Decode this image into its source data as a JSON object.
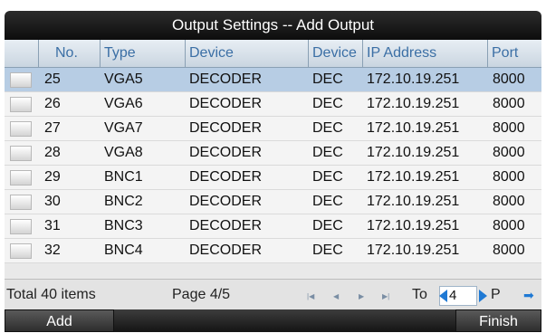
{
  "window": {
    "title": "Output Settings -- Add Output"
  },
  "table": {
    "columns": [
      "No.",
      "Type",
      "Device",
      "Device",
      "IP Address",
      "Port"
    ],
    "rows": [
      {
        "no": "25",
        "type": "VGA5",
        "device": "DECODER",
        "device_short": "DEC",
        "ip": "172.10.19.251",
        "port": "8000",
        "selected": true
      },
      {
        "no": "26",
        "type": "VGA6",
        "device": "DECODER",
        "device_short": "DEC",
        "ip": "172.10.19.251",
        "port": "8000",
        "selected": false
      },
      {
        "no": "27",
        "type": "VGA7",
        "device": "DECODER",
        "device_short": "DEC",
        "ip": "172.10.19.251",
        "port": "8000",
        "selected": false
      },
      {
        "no": "28",
        "type": "VGA8",
        "device": "DECODER",
        "device_short": "DEC",
        "ip": "172.10.19.251",
        "port": "8000",
        "selected": false
      },
      {
        "no": "29",
        "type": "BNC1",
        "device": "DECODER",
        "device_short": "DEC",
        "ip": "172.10.19.251",
        "port": "8000",
        "selected": false
      },
      {
        "no": "30",
        "type": "BNC2",
        "device": "DECODER",
        "device_short": "DEC",
        "ip": "172.10.19.251",
        "port": "8000",
        "selected": false
      },
      {
        "no": "31",
        "type": "BNC3",
        "device": "DECODER",
        "device_short": "DEC",
        "ip": "172.10.19.251",
        "port": "8000",
        "selected": false
      },
      {
        "no": "32",
        "type": "BNC4",
        "device": "DECODER",
        "device_short": "DEC",
        "ip": "172.10.19.251",
        "port": "8000",
        "selected": false
      }
    ]
  },
  "footer": {
    "total": "Total 40 items",
    "page": "Page 4/5",
    "to_label": "To",
    "page_input": "4",
    "p_label": "P",
    "nav": {
      "first": "|◀",
      "prev": "◀",
      "next": "▶",
      "last": "▶|",
      "go": "➡"
    }
  },
  "buttons": {
    "add": "Add",
    "finish": "Finish"
  },
  "colors": {
    "selected_row": "#b7cde4",
    "header_text": "#3b6fa5",
    "arrow": "#1f79d4"
  }
}
